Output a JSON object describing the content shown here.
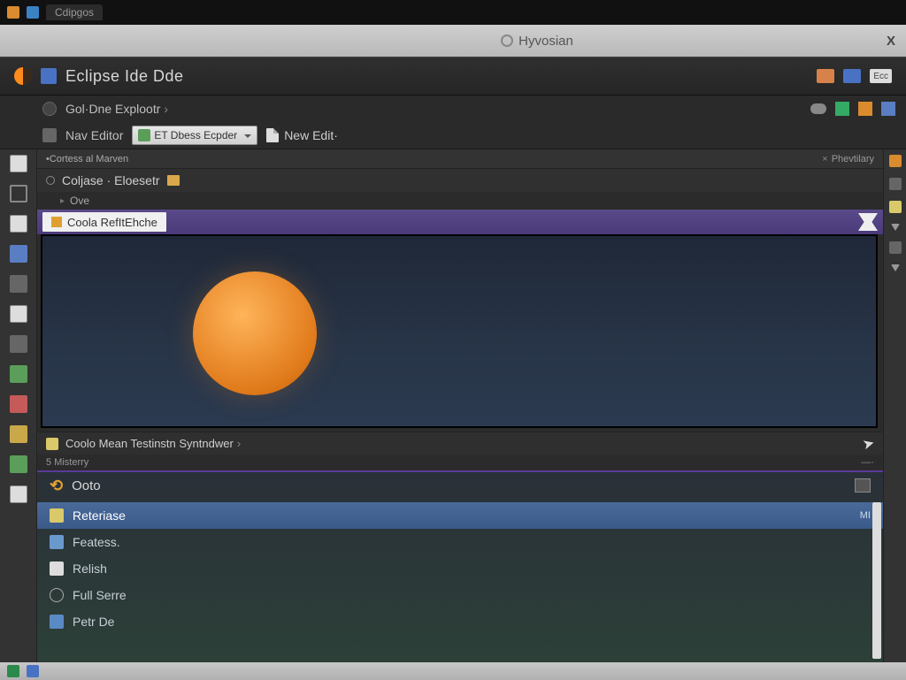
{
  "oschrome": {
    "tab": "Cdipgos"
  },
  "titlebar": {
    "center": "Hyvosian",
    "close": "X"
  },
  "productbar": {
    "title": "Eclipse Ide Dde",
    "quick": "Ecc"
  },
  "toolbar": {
    "row1_label": "Gol·Dne Explootr",
    "row2_label": "Nav Editor",
    "combo": "ET Dbess Ecpder",
    "newedit": "New Edit·"
  },
  "panelhead": {
    "left": "•Cortess al Marven",
    "right": "Phevtilary"
  },
  "explorer": {
    "title": "Coljase · Eloesetr",
    "sub": "Ove"
  },
  "filetab": {
    "name": "Coola RefItEhche"
  },
  "midstrip": {
    "title": "Coolo Mean Testinstn Syntndwer"
  },
  "miscrow": {
    "label": "5 Misterry"
  },
  "results": {
    "head": "Ooto",
    "items": [
      {
        "icon": "y",
        "label": "Reteriase",
        "tag": "MI",
        "sel": true
      },
      {
        "icon": "b",
        "label": "Featess.",
        "tag": ""
      },
      {
        "icon": "doc",
        "label": "Relish",
        "tag": ""
      },
      {
        "icon": "g",
        "label": "Full Serre",
        "tag": ""
      },
      {
        "icon": "bl",
        "label": "Petr De",
        "tag": ""
      }
    ]
  }
}
